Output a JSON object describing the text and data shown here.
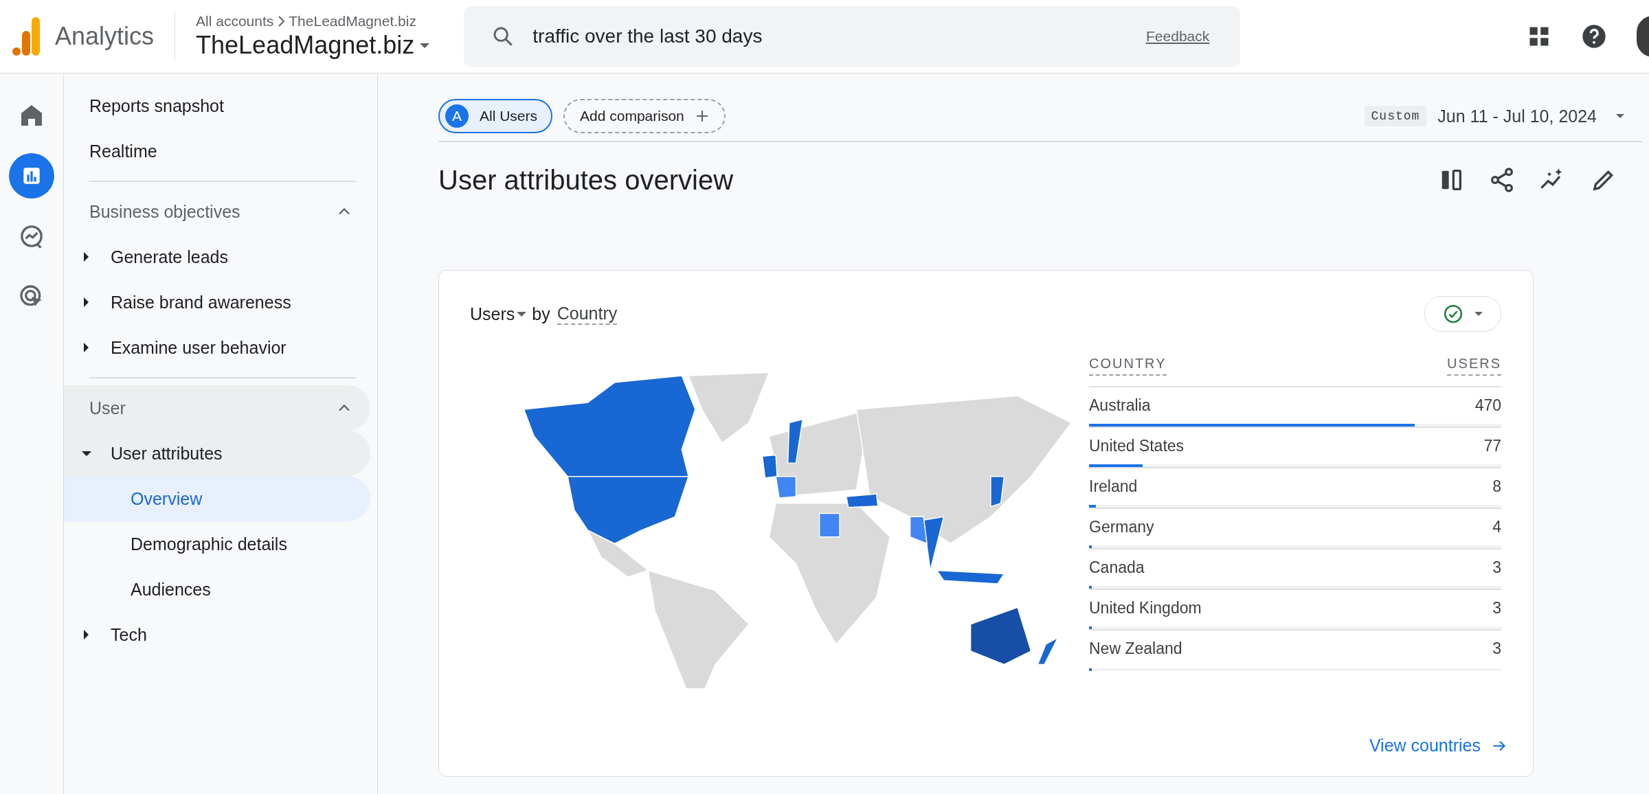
{
  "app": {
    "name": "Analytics"
  },
  "account": {
    "breadcrumb": [
      "All accounts",
      "TheLeadMagnet.biz"
    ],
    "property": "TheLeadMagnet.biz"
  },
  "search": {
    "value": "traffic over the last 30 days",
    "feedback": "Feedback"
  },
  "rail": [
    {
      "kind": "home",
      "selected": false
    },
    {
      "kind": "reports",
      "selected": true
    },
    {
      "kind": "explore",
      "selected": false
    },
    {
      "kind": "advertising",
      "selected": false
    }
  ],
  "sidebar": {
    "items": [
      {
        "label": "Reports snapshot",
        "selected": false
      },
      {
        "label": "Realtime",
        "selected": false
      }
    ],
    "sections": [
      {
        "title": "Business objectives",
        "expanded": true,
        "items": [
          {
            "label": "Generate leads",
            "expanded": false,
            "selected": false
          },
          {
            "label": "Raise brand awareness",
            "expanded": false,
            "selected": false
          },
          {
            "label": "Examine user behavior",
            "expanded": false,
            "selected": false
          }
        ]
      },
      {
        "title": "User",
        "expanded": true,
        "items": [
          {
            "label": "User attributes",
            "expanded": true,
            "selected": false,
            "children": [
              {
                "label": "Overview",
                "selected": true
              },
              {
                "label": "Demographic details",
                "selected": false
              },
              {
                "label": "Audiences",
                "selected": false
              }
            ]
          },
          {
            "label": "Tech",
            "expanded": false,
            "selected": false
          }
        ]
      }
    ]
  },
  "comparisons": {
    "segment": {
      "badge": "A",
      "label": "All Users"
    },
    "add": "Add comparison"
  },
  "date_range": {
    "preset": "Custom",
    "range": "Jun 11 - Jul 10, 2024"
  },
  "title": "User attributes overview",
  "card": {
    "metric": "Users",
    "connector": "by",
    "dimension": "Country",
    "table": {
      "columns": [
        "COUNTRY",
        "USERS"
      ],
      "rows": [
        {
          "country": "Australia",
          "users": "470",
          "level": 0.79
        },
        {
          "country": "United States",
          "users": "77",
          "level": 0.13
        },
        {
          "country": "Ireland",
          "users": "8",
          "level": 0.016
        },
        {
          "country": "Germany",
          "users": "4",
          "level": 0.007
        },
        {
          "country": "Canada",
          "users": "3",
          "level": 0.006
        },
        {
          "country": "United Kingdom",
          "users": "3",
          "level": 0.006
        },
        {
          "country": "New Zealand",
          "users": "3",
          "level": 0.006
        }
      ]
    },
    "link": "View countries"
  }
}
